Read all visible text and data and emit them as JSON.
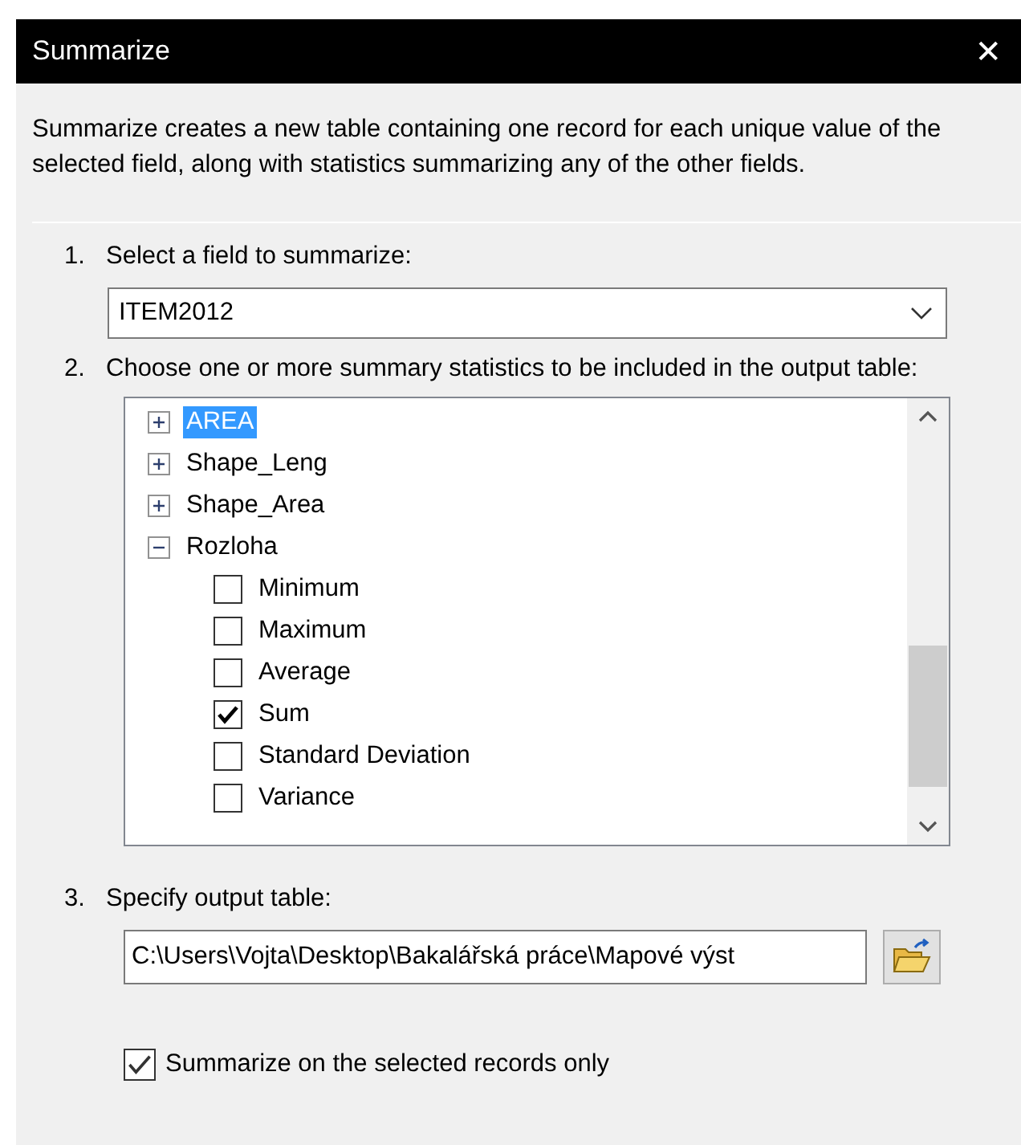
{
  "window": {
    "title": "Summarize",
    "close": "✕"
  },
  "description": "Summarize creates a new table containing one record for each unique value of the selected field, along with statistics summarizing any of the other fields.",
  "step1": {
    "number": "1.",
    "label": "Select a field to summarize:",
    "value": "ITEM2012"
  },
  "step2": {
    "number": "2.",
    "label": "Choose one or more summary statistics to be included in the output table:",
    "tree": [
      {
        "label": "AREA",
        "expanded": false,
        "selected": true
      },
      {
        "label": "Shape_Leng",
        "expanded": false,
        "selected": false
      },
      {
        "label": "Shape_Area",
        "expanded": false,
        "selected": false
      },
      {
        "label": "Rozloha",
        "expanded": true,
        "selected": false,
        "children": [
          {
            "label": "Minimum",
            "checked": false
          },
          {
            "label": "Maximum",
            "checked": false
          },
          {
            "label": "Average",
            "checked": false
          },
          {
            "label": "Sum",
            "checked": true
          },
          {
            "label": "Standard Deviation",
            "checked": false
          },
          {
            "label": "Variance",
            "checked": false
          }
        ]
      }
    ]
  },
  "step3": {
    "number": "3.",
    "label": "Specify output table:",
    "value": "C:\\Users\\Vojta\\Desktop\\Bakalářská práce\\Mapové výst"
  },
  "selected_only": {
    "label": "Summarize on the selected records only",
    "checked": true
  }
}
